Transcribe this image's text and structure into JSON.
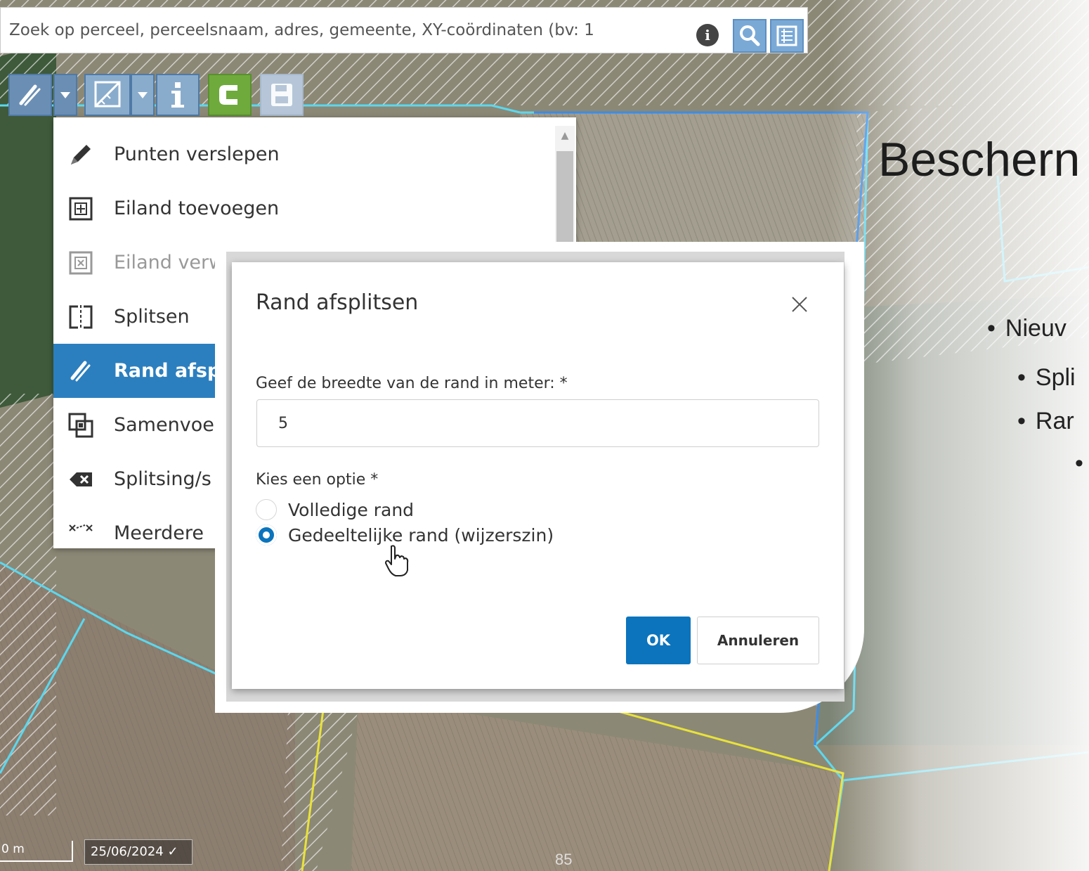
{
  "search": {
    "placeholder": "Zoek op perceel, perceelsnaam, adres, gemeente, XY-coördinaten (bv: 1"
  },
  "menu": {
    "items": [
      {
        "label": "Punten verslepen",
        "icon": "pencil-icon"
      },
      {
        "label": "Eiland toevoegen",
        "icon": "add-island-icon"
      },
      {
        "label": "Eiland verwijd",
        "icon": "remove-island-icon"
      },
      {
        "label": "Splitsen",
        "icon": "split-icon"
      },
      {
        "label": "Rand afspl",
        "icon": "split-edge-icon"
      },
      {
        "label": "Samenvoe",
        "icon": "merge-icon"
      },
      {
        "label": "Splitsing/s",
        "icon": "backspace-icon"
      },
      {
        "label": "Meerdere",
        "icon": "multi-select-icon"
      }
    ]
  },
  "dialog": {
    "title": "Rand afsplitsen",
    "width_label": "Geef de breedte van de rand in meter: *",
    "width_value": "5",
    "option_label": "Kies een optie *",
    "options": [
      {
        "label": "Volledige rand",
        "checked": false
      },
      {
        "label": "Gedeeltelijke rand (wijzerszin)",
        "checked": true
      }
    ],
    "ok_label": "OK",
    "cancel_label": "Annuleren"
  },
  "map": {
    "scale_label": "0 m",
    "date_label": "25/06/2024 ✓"
  },
  "slide": {
    "title": "Beschern",
    "bullets": [
      "Nieuv",
      "Spli",
      "Rar"
    ],
    "page_number": "85"
  },
  "colors": {
    "accent": "#0b74bd",
    "menu_active": "#2b7fbf",
    "parcel_outline": "#5ad8ef",
    "selection_outline": "#e8e23a",
    "c_tool": "#6faa3c"
  }
}
